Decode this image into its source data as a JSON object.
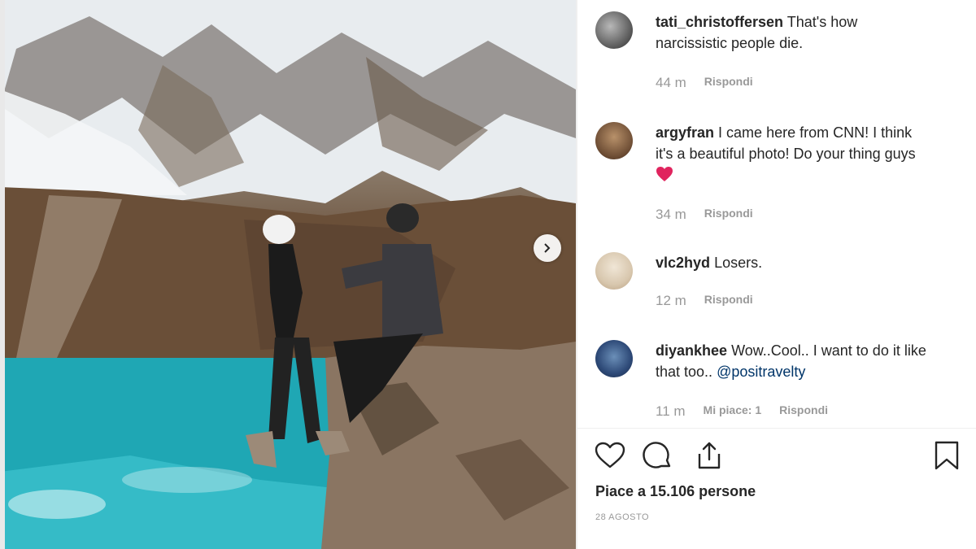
{
  "post": {
    "comments": [
      {
        "username": "tati_christoffersen",
        "text": "That's how narcissistic people die.",
        "time": "44 m",
        "reply_label": "Rispondi"
      },
      {
        "username": "argyfran",
        "text": "I came here from CNN! I think it's a beautiful photo! Do your thing guys",
        "time": "34 m",
        "reply_label": "Rispondi"
      },
      {
        "username": "vlc2hyd",
        "text": "Losers.",
        "time": "12 m",
        "reply_label": "Rispondi"
      },
      {
        "username": "diyankhee",
        "text": "Wow..Cool.. I want to do it like that too..",
        "mention": "@positravelty",
        "time": "11 m",
        "likes_label": "Mi piace: 1",
        "reply_label": "Rispondi"
      }
    ],
    "likes_text": "Piace a 15.106 persone",
    "date": "28 AGOSTO"
  },
  "icons": {
    "like": "heart-icon",
    "comment": "comment-icon",
    "share": "share-icon",
    "save": "bookmark-icon",
    "next": "chevron-right-icon"
  },
  "colors": {
    "heart_emoji": "#e0245e",
    "lake": "#1fa7b4",
    "mention": "#003569"
  }
}
